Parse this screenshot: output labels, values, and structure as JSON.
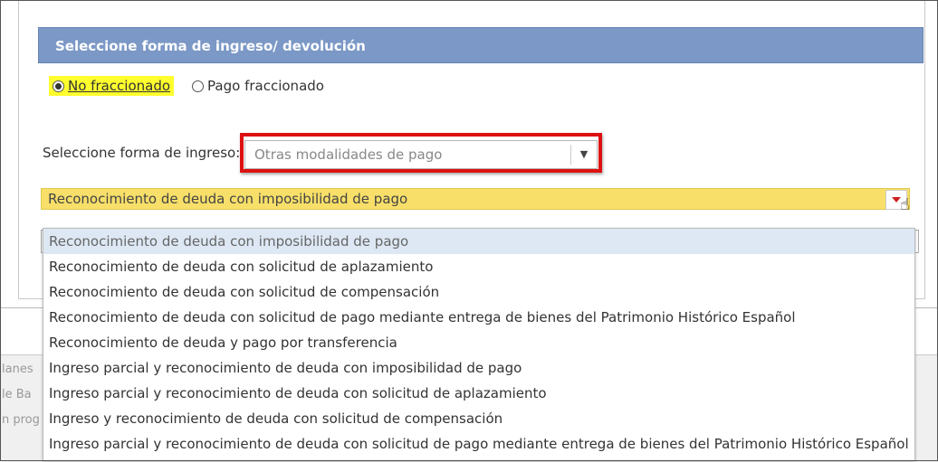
{
  "panel": {
    "title": "Seleccione forma de ingreso/ devolución"
  },
  "payment_type": {
    "options": [
      {
        "label": "No fraccionado",
        "selected": true
      },
      {
        "label": "Pago fraccionado",
        "selected": false
      }
    ]
  },
  "forma_ingreso": {
    "label": "Seleccione forma de ingreso:",
    "value": "Otras modalidades de pago"
  },
  "modalidad": {
    "value": "Reconocimiento de deuda con imposibilidad de pago",
    "options": [
      "Reconocimiento de deuda con imposibilidad de pago",
      "Reconocimiento de deuda con solicitud de aplazamiento",
      "Reconocimiento de deuda con solicitud de compensación",
      "Reconocimiento de deuda con solicitud de pago mediante entrega de bienes del Patrimonio Histórico Español",
      "Reconocimiento de deuda y pago por transferencia",
      "Ingreso parcial y reconocimiento de deuda con imposibilidad de pago",
      "Ingreso parcial y reconocimiento de deuda con solicitud de aplazamiento",
      "Ingreso y reconocimiento de deuda con solicitud de compensación",
      "Ingreso parcial y reconocimiento de deuda con solicitud de pago mediante entrega de bienes del Patrimonio Histórico Español"
    ]
  },
  "footer_fragments": [
    "lanes",
    "le Ba",
    "n prog"
  ],
  "colors": {
    "header": "#7b98c6",
    "highlight": "#ffff2e",
    "modal_select": "#f7df69",
    "red_frame": "#dd1111"
  }
}
